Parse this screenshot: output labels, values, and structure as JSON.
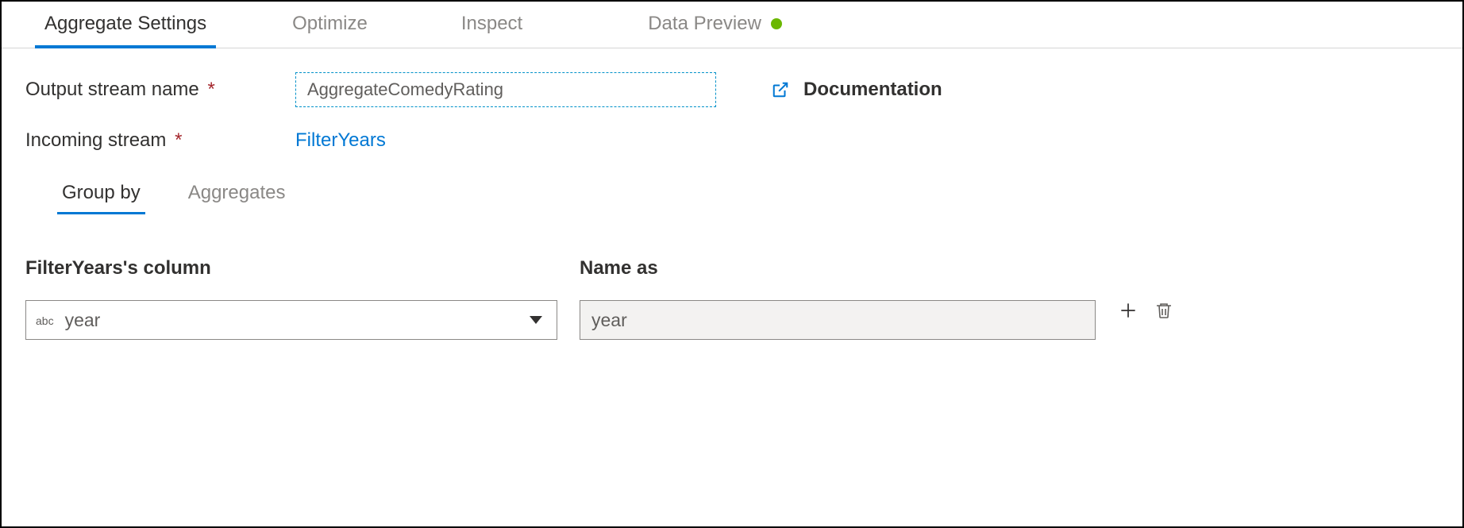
{
  "tabs": {
    "aggregate_settings": "Aggregate Settings",
    "optimize": "Optimize",
    "inspect": "Inspect",
    "data_preview": "Data Preview"
  },
  "fields": {
    "output_stream_label": "Output stream name",
    "output_stream_value": "AggregateComedyRating",
    "incoming_stream_label": "Incoming stream",
    "incoming_stream_value": "FilterYears"
  },
  "documentation_label": "Documentation",
  "subtabs": {
    "group_by": "Group by",
    "aggregates": "Aggregates"
  },
  "columns": {
    "source_header": "FilterYears's column",
    "name_as_header": "Name as",
    "type_tag": "abc",
    "selected_column": "year",
    "name_as_value": "year"
  }
}
